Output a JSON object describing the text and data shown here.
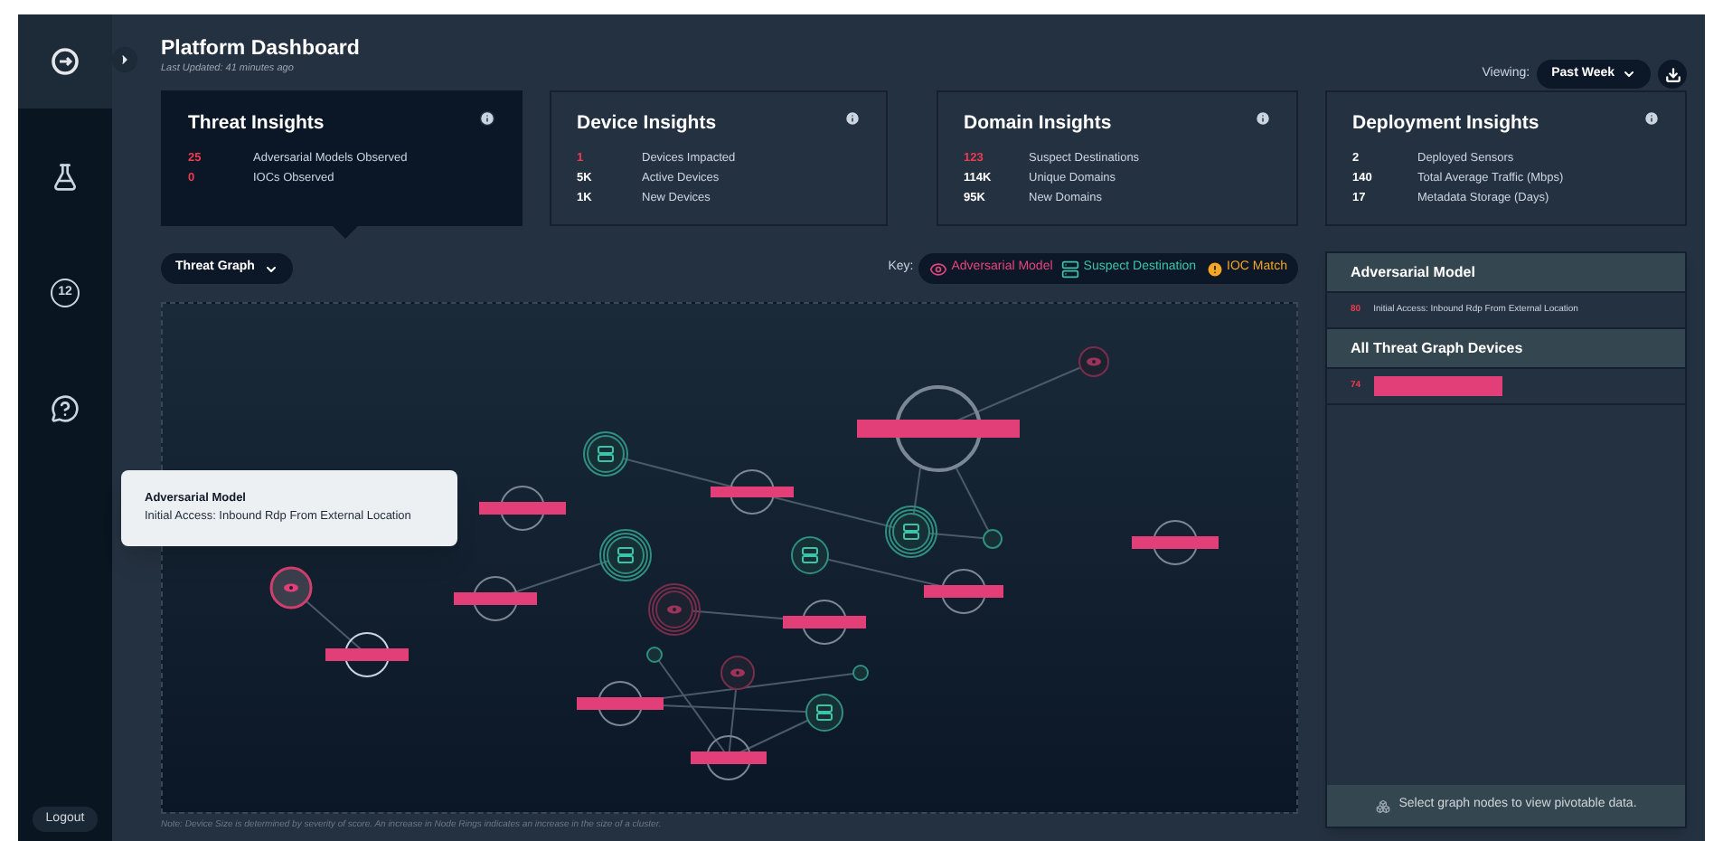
{
  "sidebar": {
    "items": [
      {
        "kind": "home",
        "selected": true
      },
      {
        "kind": "flask",
        "selected": false
      },
      {
        "kind": "count",
        "label": "12",
        "selected": false
      },
      {
        "kind": "help",
        "selected": false
      }
    ],
    "logout": "Logout"
  },
  "header": {
    "title": "Platform Dashboard",
    "subtitle": "Last Updated: 41 minutes ago",
    "viewing_label": "Viewing:",
    "viewing_value": "Past Week"
  },
  "insight_cards": [
    {
      "title": "Threat Insights",
      "selected": true,
      "stats": [
        {
          "value": "25",
          "label": "Adversarial Models Observed",
          "alert": true
        },
        {
          "value": "0",
          "label": "IOCs Observed",
          "alert": true
        }
      ]
    },
    {
      "title": "Device Insights",
      "selected": false,
      "stats": [
        {
          "value": "1",
          "label": "Devices Impacted",
          "alert": true
        },
        {
          "value": "5K",
          "label": "Active Devices",
          "alert": false
        },
        {
          "value": "1K",
          "label": "New Devices",
          "alert": false
        }
      ]
    },
    {
      "title": "Domain Insights",
      "selected": false,
      "stats": [
        {
          "value": "123",
          "label": "Suspect Destinations",
          "alert": true
        },
        {
          "value": "114K",
          "label": "Unique Domains",
          "alert": false
        },
        {
          "value": "95K",
          "label": "New Domains",
          "alert": false
        }
      ]
    },
    {
      "title": "Deployment Insights",
      "selected": false,
      "stats": [
        {
          "value": "2",
          "label": "Deployed Sensors",
          "alert": false
        },
        {
          "value": "140",
          "label": "Total Average Traffic (Mbps)",
          "alert": false
        },
        {
          "value": "17",
          "label": "Metadata Storage (Days)",
          "alert": false
        }
      ]
    }
  ],
  "graph": {
    "view": "Threat Graph",
    "key_label": "Key:",
    "legend": [
      {
        "kind": "model",
        "label": "Adversarial Model",
        "color": "#e8457f"
      },
      {
        "kind": "destination",
        "label": "Suspect Destination",
        "color": "#3cc4a8"
      },
      {
        "kind": "ioc",
        "label": "IOC Match",
        "color": "#f5a623"
      }
    ],
    "note": "Note: Device Size is determined by severity of score. An increase in Node Rings indicates an increase in the size of a cluster.",
    "tooltip": {
      "title": "Adversarial Model",
      "text": "Initial Access: Inbound Rdp From External Location"
    }
  },
  "details": {
    "sections": [
      {
        "title": "Adversarial Model",
        "rows": [
          {
            "kind": "text",
            "count": "80",
            "text": "Initial Access: Inbound Rdp From External Location"
          }
        ]
      },
      {
        "title": "All Threat Graph Devices",
        "rows": [
          {
            "kind": "redacted",
            "count": "74"
          }
        ]
      }
    ],
    "footer": "Select graph nodes to view pivotable data."
  }
}
